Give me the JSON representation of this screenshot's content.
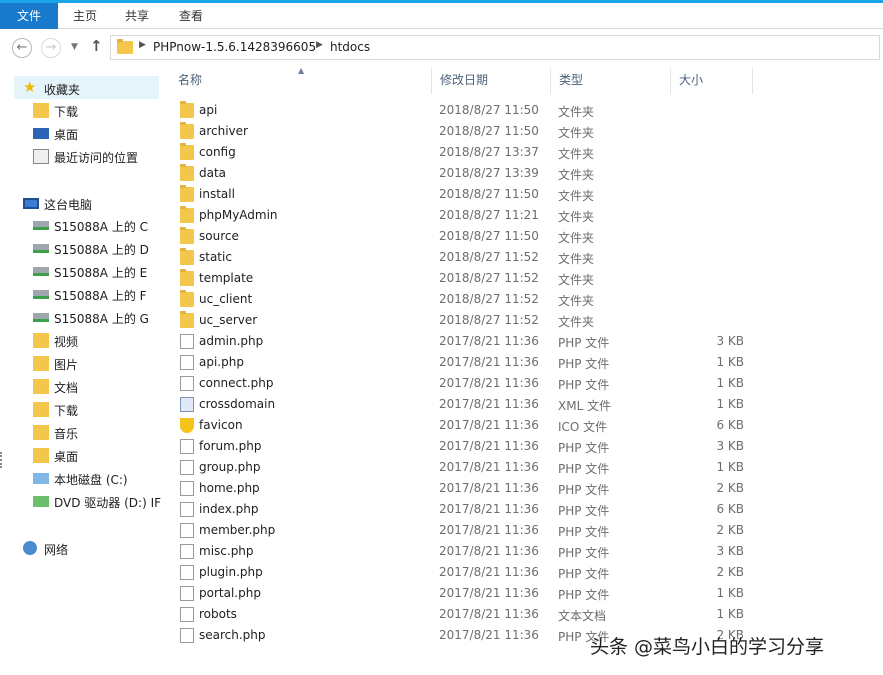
{
  "ribbon": {
    "tabs": [
      "文件",
      "主页",
      "共享",
      "查看"
    ],
    "accent": "#1979ca"
  },
  "address": {
    "crumbs": [
      "PHPnow-1.5.6.1428396605",
      "htdocs"
    ]
  },
  "navpane": {
    "favorites": {
      "label": "收藏夹",
      "items": [
        "下载",
        "桌面",
        "最近访问的位置"
      ]
    },
    "this_pc": {
      "label": "这台电脑",
      "items": [
        "S15088A 上的 C",
        "S15088A 上的 D",
        "S15088A 上的 E",
        "S15088A 上的 F",
        "S15088A 上的 G",
        "视频",
        "图片",
        "文档",
        "下载",
        "音乐",
        "桌面",
        "本地磁盘 (C:)",
        "DVD 驱动器 (D:) IF"
      ]
    },
    "network": {
      "label": "网络"
    }
  },
  "columns": {
    "name": "名称",
    "date": "修改日期",
    "type": "类型",
    "size": "大小"
  },
  "files": [
    {
      "name": "api",
      "date": "2018/8/27 11:50",
      "type": "文件夹",
      "size": "",
      "icon": "folder-icon"
    },
    {
      "name": "archiver",
      "date": "2018/8/27 11:50",
      "type": "文件夹",
      "size": "",
      "icon": "folder-icon"
    },
    {
      "name": "config",
      "date": "2018/8/27 13:37",
      "type": "文件夹",
      "size": "",
      "icon": "folder-icon"
    },
    {
      "name": "data",
      "date": "2018/8/27 13:39",
      "type": "文件夹",
      "size": "",
      "icon": "folder-icon"
    },
    {
      "name": "install",
      "date": "2018/8/27 11:50",
      "type": "文件夹",
      "size": "",
      "icon": "folder-icon"
    },
    {
      "name": "phpMyAdmin",
      "date": "2018/8/27 11:21",
      "type": "文件夹",
      "size": "",
      "icon": "folder-icon"
    },
    {
      "name": "source",
      "date": "2018/8/27 11:50",
      "type": "文件夹",
      "size": "",
      "icon": "folder-icon"
    },
    {
      "name": "static",
      "date": "2018/8/27 11:52",
      "type": "文件夹",
      "size": "",
      "icon": "folder-icon"
    },
    {
      "name": "template",
      "date": "2018/8/27 11:52",
      "type": "文件夹",
      "size": "",
      "icon": "folder-icon"
    },
    {
      "name": "uc_client",
      "date": "2018/8/27 11:52",
      "type": "文件夹",
      "size": "",
      "icon": "folder-icon"
    },
    {
      "name": "uc_server",
      "date": "2018/8/27 11:52",
      "type": "文件夹",
      "size": "",
      "icon": "folder-icon"
    },
    {
      "name": "admin.php",
      "date": "2017/8/21 11:36",
      "type": "PHP 文件",
      "size": "3 KB",
      "icon": "document-icon"
    },
    {
      "name": "api.php",
      "date": "2017/8/21 11:36",
      "type": "PHP 文件",
      "size": "1 KB",
      "icon": "document-icon"
    },
    {
      "name": "connect.php",
      "date": "2017/8/21 11:36",
      "type": "PHP 文件",
      "size": "1 KB",
      "icon": "document-icon"
    },
    {
      "name": "crossdomain",
      "date": "2017/8/21 11:36",
      "type": "XML 文件",
      "size": "1 KB",
      "icon": "xml-icon"
    },
    {
      "name": "favicon",
      "date": "2017/8/21 11:36",
      "type": "ICO 文件",
      "size": "6 KB",
      "icon": "ico-icon"
    },
    {
      "name": "forum.php",
      "date": "2017/8/21 11:36",
      "type": "PHP 文件",
      "size": "3 KB",
      "icon": "document-icon"
    },
    {
      "name": "group.php",
      "date": "2017/8/21 11:36",
      "type": "PHP 文件",
      "size": "1 KB",
      "icon": "document-icon"
    },
    {
      "name": "home.php",
      "date": "2017/8/21 11:36",
      "type": "PHP 文件",
      "size": "2 KB",
      "icon": "document-icon"
    },
    {
      "name": "index.php",
      "date": "2017/8/21 11:36",
      "type": "PHP 文件",
      "size": "6 KB",
      "icon": "document-icon"
    },
    {
      "name": "member.php",
      "date": "2017/8/21 11:36",
      "type": "PHP 文件",
      "size": "2 KB",
      "icon": "document-icon"
    },
    {
      "name": "misc.php",
      "date": "2017/8/21 11:36",
      "type": "PHP 文件",
      "size": "3 KB",
      "icon": "document-icon"
    },
    {
      "name": "plugin.php",
      "date": "2017/8/21 11:36",
      "type": "PHP 文件",
      "size": "2 KB",
      "icon": "document-icon"
    },
    {
      "name": "portal.php",
      "date": "2017/8/21 11:36",
      "type": "PHP 文件",
      "size": "1 KB",
      "icon": "document-icon"
    },
    {
      "name": "robots",
      "date": "2017/8/21 11:36",
      "type": "文本文档",
      "size": "1 KB",
      "icon": "text-document-icon"
    },
    {
      "name": "search.php",
      "date": "2017/8/21 11:36",
      "type": "PHP 文件",
      "size": "2 KB",
      "icon": "document-icon"
    }
  ],
  "watermark": "头条 @菜鸟小白的学习分享"
}
